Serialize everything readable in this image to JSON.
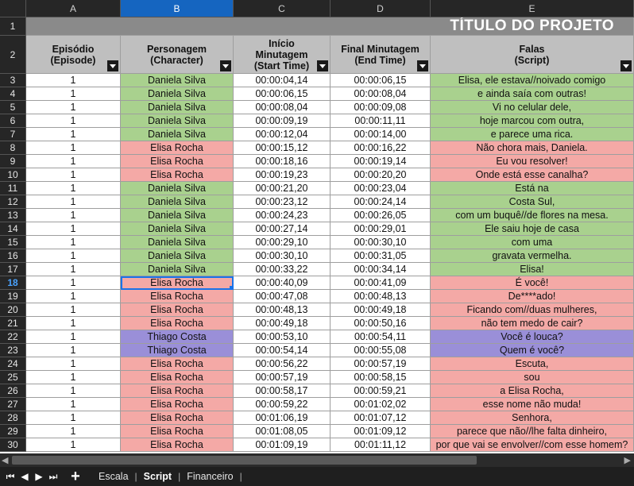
{
  "columns": [
    "A",
    "B",
    "C",
    "D",
    "E"
  ],
  "selected_column": "B",
  "selected_row": "18",
  "title": "TÍTULO DO PROJETO",
  "headers": {
    "episode": [
      "Episódio",
      "(Episode)"
    ],
    "character": [
      "Personagem",
      "(Character)"
    ],
    "start": [
      "Início",
      "Minutagem",
      "(Start Time)"
    ],
    "end": [
      "Final Minutagem",
      "(End Time)"
    ],
    "lines": [
      "Falas",
      "(Script)"
    ]
  },
  "colors": {
    "green": "#a9d18e",
    "red": "#f4a9a6",
    "purple": "#9a8fd8"
  },
  "rows": [
    {
      "n": "3",
      "ep": "1",
      "char": "Daniela Silva",
      "start": "00:00:04,14",
      "end": "00:00:06,15",
      "text": "Elisa, ele estava//noivado comigo",
      "color": "g"
    },
    {
      "n": "4",
      "ep": "1",
      "char": "Daniela Silva",
      "start": "00:00:06,15",
      "end": "00:00:08,04",
      "text": "e ainda saía com outras!",
      "color": "g"
    },
    {
      "n": "5",
      "ep": "1",
      "char": "Daniela Silva",
      "start": "00:00:08,04",
      "end": "00:00:09,08",
      "text": "Vi no celular dele,",
      "color": "g"
    },
    {
      "n": "6",
      "ep": "1",
      "char": "Daniela Silva",
      "start": "00:00:09,19",
      "end": "00:00:11,11",
      "text": "hoje marcou com outra,",
      "color": "g"
    },
    {
      "n": "7",
      "ep": "1",
      "char": "Daniela Silva",
      "start": "00:00:12,04",
      "end": "00:00:14,00",
      "text": "e parece uma rica.",
      "color": "g"
    },
    {
      "n": "8",
      "ep": "1",
      "char": "Elisa Rocha",
      "start": "00:00:15,12",
      "end": "00:00:16,22",
      "text": "Não chora mais, Daniela.",
      "color": "r"
    },
    {
      "n": "9",
      "ep": "1",
      "char": "Elisa Rocha",
      "start": "00:00:18,16",
      "end": "00:00:19,14",
      "text": "Eu vou resolver!",
      "color": "r"
    },
    {
      "n": "10",
      "ep": "1",
      "char": "Elisa Rocha",
      "start": "00:00:19,23",
      "end": "00:00:20,20",
      "text": "Onde está esse canalha?",
      "color": "r"
    },
    {
      "n": "11",
      "ep": "1",
      "char": "Daniela Silva",
      "start": "00:00:21,20",
      "end": "00:00:23,04",
      "text": "Está na",
      "color": "g"
    },
    {
      "n": "12",
      "ep": "1",
      "char": "Daniela Silva",
      "start": "00:00:23,12",
      "end": "00:00:24,14",
      "text": "Costa Sul,",
      "color": "g"
    },
    {
      "n": "13",
      "ep": "1",
      "char": "Daniela Silva",
      "start": "00:00:24,23",
      "end": "00:00:26,05",
      "text": "com um buquê//de flores na mesa.",
      "color": "g"
    },
    {
      "n": "14",
      "ep": "1",
      "char": "Daniela Silva",
      "start": "00:00:27,14",
      "end": "00:00:29,01",
      "text": "Ele saiu hoje de casa",
      "color": "g"
    },
    {
      "n": "15",
      "ep": "1",
      "char": "Daniela Silva",
      "start": "00:00:29,10",
      "end": "00:00:30,10",
      "text": "com uma",
      "color": "g"
    },
    {
      "n": "16",
      "ep": "1",
      "char": "Daniela Silva",
      "start": "00:00:30,10",
      "end": "00:00:31,05",
      "text": "gravata vermelha.",
      "color": "g"
    },
    {
      "n": "17",
      "ep": "1",
      "char": "Daniela Silva",
      "start": "00:00:33,22",
      "end": "00:00:34,14",
      "text": "Elisa!",
      "color": "g"
    },
    {
      "n": "18",
      "ep": "1",
      "char": "Elisa Rocha",
      "start": "00:00:40,09",
      "end": "00:00:41,09",
      "text": "É você!",
      "color": "r"
    },
    {
      "n": "19",
      "ep": "1",
      "char": "Elisa Rocha",
      "start": "00:00:47,08",
      "end": "00:00:48,13",
      "text": "De****ado!",
      "color": "r"
    },
    {
      "n": "20",
      "ep": "1",
      "char": "Elisa Rocha",
      "start": "00:00:48,13",
      "end": "00:00:49,18",
      "text": "Ficando com//duas mulheres,",
      "color": "r"
    },
    {
      "n": "21",
      "ep": "1",
      "char": "Elisa Rocha",
      "start": "00:00:49,18",
      "end": "00:00:50,16",
      "text": "não tem medo de cair?",
      "color": "r"
    },
    {
      "n": "22",
      "ep": "1",
      "char": "Thiago Costa",
      "start": "00:00:53,10",
      "end": "00:00:54,11",
      "text": "Você é louca?",
      "color": "p"
    },
    {
      "n": "23",
      "ep": "1",
      "char": "Thiago Costa",
      "start": "00:00:54,14",
      "end": "00:00:55,08",
      "text": "Quem é você?",
      "color": "p"
    },
    {
      "n": "24",
      "ep": "1",
      "char": "Elisa Rocha",
      "start": "00:00:56,22",
      "end": "00:00:57,19",
      "text": "Escuta,",
      "color": "r"
    },
    {
      "n": "25",
      "ep": "1",
      "char": "Elisa Rocha",
      "start": "00:00:57,19",
      "end": "00:00:58,15",
      "text": "sou",
      "color": "r"
    },
    {
      "n": "26",
      "ep": "1",
      "char": "Elisa Rocha",
      "start": "00:00:58,17",
      "end": "00:00:59,21",
      "text": "a Elisa Rocha,",
      "color": "r"
    },
    {
      "n": "27",
      "ep": "1",
      "char": "Elisa Rocha",
      "start": "00:00:59,22",
      "end": "00:01:02,02",
      "text": "esse nome não muda!",
      "color": "r"
    },
    {
      "n": "28",
      "ep": "1",
      "char": "Elisa Rocha",
      "start": "00:01:06,19",
      "end": "00:01:07,12",
      "text": "Senhora,",
      "color": "r"
    },
    {
      "n": "29",
      "ep": "1",
      "char": "Elisa Rocha",
      "start": "00:01:08,05",
      "end": "00:01:09,12",
      "text": "parece que não//lhe falta dinheiro,",
      "color": "r"
    },
    {
      "n": "30",
      "ep": "1",
      "char": "Elisa Rocha",
      "start": "00:01:09,19",
      "end": "00:01:11,12",
      "text": "por que vai se envolver//com esse homem?",
      "color": "r"
    }
  ],
  "sheet_tabs": [
    {
      "label": "Escala",
      "active": false
    },
    {
      "label": "Script",
      "active": true
    },
    {
      "label": "Financeiro",
      "active": false
    }
  ],
  "nav_icons": [
    "first-sheet-icon",
    "prev-sheet-icon",
    "next-sheet-icon",
    "last-sheet-icon"
  ]
}
